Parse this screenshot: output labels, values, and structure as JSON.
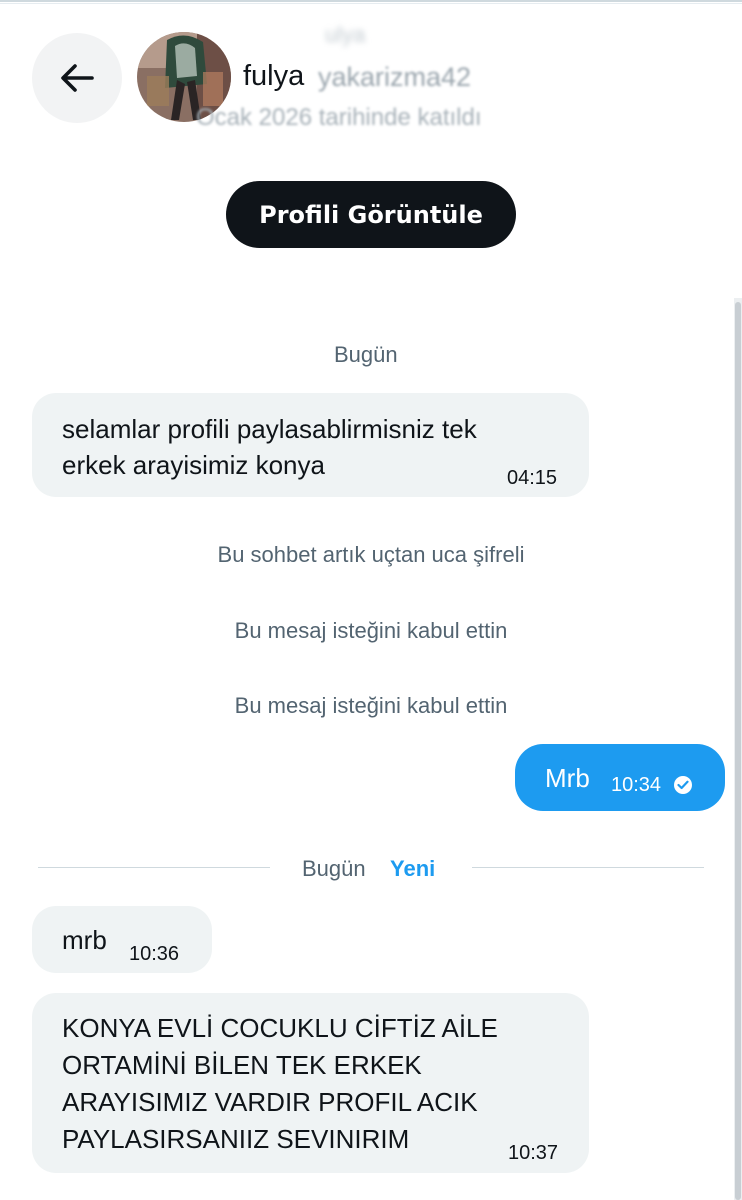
{
  "header": {
    "back_label": "back",
    "display_name": "fulya",
    "handle": "yakarizma42",
    "joined": "Ocak 2026 tarihinde katıldı",
    "top_blur": "ulya"
  },
  "profile_button": "Profili Görüntüle",
  "date_separator_1": "Bugün",
  "messages": {
    "m1_line1": "selamlar profili paylasablirmisniz tek",
    "m1_line2": "erkek arayisimiz konya",
    "m1_time": "04:15",
    "system_1": "Bu sohbet artık uçtan uca şifreli",
    "system_2": "Bu mesaj isteğini kabul ettin",
    "system_3": "Bu mesaj isteğini kabul ettin",
    "m2_text": "Mrb",
    "m2_time": "10:34",
    "m3_text": "mrb",
    "m3_time": "10:36",
    "m4_line1": "KONYA EVLİ COCUKLU CİFTİZ AİLE",
    "m4_line2": "ORTAMİNİ BİLEN TEK ERKEK",
    "m4_line3": "ARAYISIMIZ VARDIR PROFIL ACIK",
    "m4_line4": "PAYLASIRSANIIZ SEVINIRIM",
    "m4_time": "10:37"
  },
  "date_separator_2": {
    "label": "Bugün",
    "new_label": "Yeni",
    "new_color": "#1d9bf0"
  },
  "colors": {
    "accent": "#1d9bf0",
    "incoming_bubble": "#eff3f4",
    "muted_text": "#536471"
  }
}
